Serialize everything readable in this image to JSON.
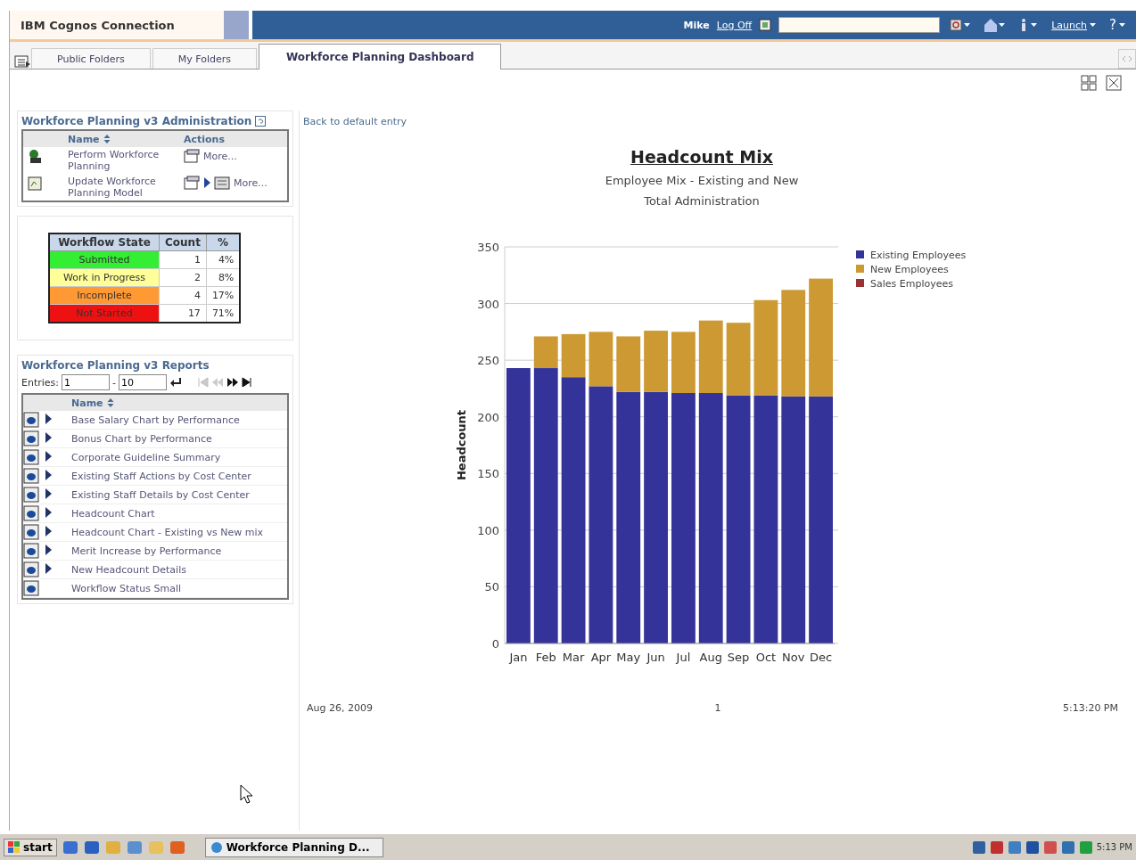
{
  "header": {
    "product": "IBM Cognos Connection",
    "user": "Mike",
    "log_off": "Log Off",
    "launch": "Launch",
    "help": "?"
  },
  "tabs": [
    {
      "label": "Public Folders",
      "selected": false
    },
    {
      "label": "My Folders",
      "selected": false
    },
    {
      "label": "Workforce Planning Dashboard",
      "selected": true
    }
  ],
  "admin_panel": {
    "title": "Workforce Planning v3 Administration",
    "columns": [
      "Name",
      "Actions"
    ],
    "rows": [
      {
        "kind": "planning",
        "name": "Perform Workforce Planning",
        "more": "More..."
      },
      {
        "kind": "model",
        "name": "Update Workforce Planning Model",
        "more": "More..."
      }
    ]
  },
  "workflow_table": {
    "columns": [
      "Workflow State",
      "Count",
      "%"
    ],
    "rows": [
      {
        "state": "Submitted",
        "count": "1",
        "percent": "4%",
        "color": "#33ee33"
      },
      {
        "state": "Work in Progress",
        "count": "2",
        "percent": "8%",
        "color": "#ffff99"
      },
      {
        "state": "Incomplete",
        "count": "4",
        "percent": "17%",
        "color": "#ff9933"
      },
      {
        "state": "Not Started",
        "count": "17",
        "percent": "71%",
        "color": "#ee1111"
      }
    ]
  },
  "reports_panel": {
    "title": "Workforce Planning v3 Reports",
    "entries_label": "Entries:",
    "from": "1",
    "separator": "-",
    "to": "10",
    "column": "Name",
    "rows": [
      {
        "name": "Base Salary Chart by Performance",
        "has_actions": true
      },
      {
        "name": "Bonus Chart by Performance",
        "has_actions": true
      },
      {
        "name": "Corporate Guideline Summary",
        "has_actions": true
      },
      {
        "name": "Existing Staff Actions by Cost Center",
        "has_actions": true
      },
      {
        "name": "Existing Staff Details by Cost Center",
        "has_actions": true
      },
      {
        "name": "Headcount Chart",
        "has_actions": true
      },
      {
        "name": "Headcount Chart - Existing vs New mix",
        "has_actions": true
      },
      {
        "name": "Merit Increase by Performance",
        "has_actions": true
      },
      {
        "name": "New Headcount Details",
        "has_actions": true
      },
      {
        "name": "Workflow Status Small",
        "has_actions": false
      }
    ]
  },
  "report": {
    "back_link": "Back to default entry",
    "subtitle": "Employee Mix - Existing and New",
    "subtitle_2": "Total Administration",
    "chart_data": {
      "type": "bar",
      "title": "Headcount Mix",
      "ylabel": "Headcount",
      "stacked": true,
      "categories": [
        "Jan",
        "Feb",
        "Mar",
        "Apr",
        "May",
        "Jun",
        "Jul",
        "Aug",
        "Sep",
        "Oct",
        "Nov",
        "Dec"
      ],
      "series": [
        {
          "name": "Existing Employees",
          "color": "#333399",
          "values": [
            243,
            243,
            235,
            227,
            222,
            222,
            221,
            221,
            219,
            219,
            218,
            218
          ]
        },
        {
          "name": "New Employees",
          "color": "#cc9933",
          "values": [
            0,
            28,
            38,
            48,
            49,
            54,
            54,
            64,
            64,
            84,
            94,
            104
          ]
        },
        {
          "name": "Sales Employees",
          "color": "#993333",
          "values": [
            0,
            0,
            0,
            0,
            0,
            0,
            0,
            0,
            0,
            0,
            0,
            0
          ]
        }
      ],
      "grid": true,
      "legend": true,
      "ylim": [
        0,
        350
      ],
      "yticks": [
        0,
        50,
        100,
        150,
        200,
        250,
        300,
        350
      ]
    },
    "footer_date": "Aug 26, 2009",
    "footer_page": "1",
    "footer_time": "5:13:20 PM"
  },
  "taskbar": {
    "start": "start",
    "task": "Workforce Planning D...",
    "clock": "5:13 PM"
  }
}
